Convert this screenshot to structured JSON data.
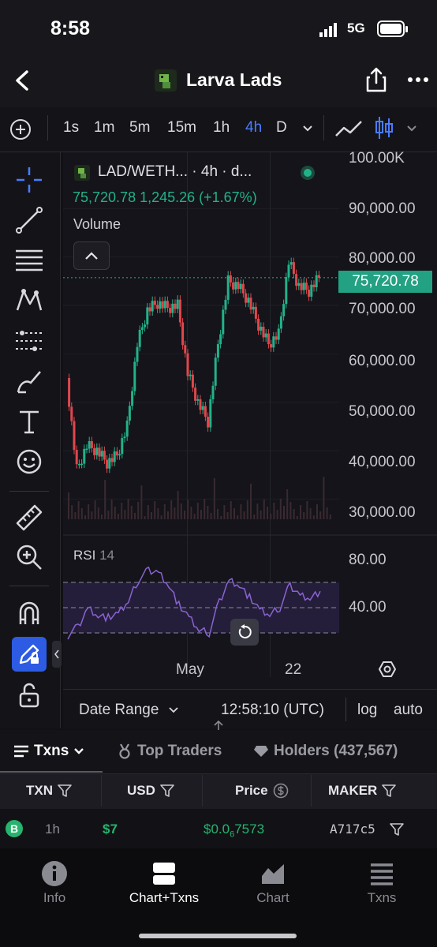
{
  "status_bar": {
    "time": "8:58",
    "network": "5G"
  },
  "header": {
    "title": "Larva Lads"
  },
  "toolbar": {
    "timeframes": [
      "1s",
      "1m",
      "5m",
      "15m",
      "1h",
      "4h",
      "D"
    ],
    "active_timeframe": "4h"
  },
  "chart": {
    "symbol_legend": "LAD/WETH... · 4h · d...",
    "legend_values": "75,720.78  1,245.26 (+1.67%)",
    "volume_label": "Volume",
    "price_ticks": [
      "100.00K",
      "90,000.00",
      "80,000.00",
      "70,000.00",
      "60,000.00",
      "50,000.00",
      "40,000.00",
      "30,000.00"
    ],
    "last_price": "75,720.78",
    "rsi_label": "RSI",
    "rsi_length": "14",
    "rsi_ticks": [
      "80.00",
      "40.00"
    ],
    "time_ticks": [
      "May",
      "22"
    ]
  },
  "chart_data": {
    "type": "line",
    "title": "LAD/WETH... · 4h · d...",
    "ylabel": "",
    "ylim": [
      25000,
      100000
    ],
    "x": [
      0,
      4,
      8,
      12,
      16,
      20,
      24,
      28,
      32,
      36,
      40,
      44,
      48,
      52,
      56,
      60,
      64,
      68,
      72,
      76,
      80,
      84,
      88,
      92,
      96,
      100
    ],
    "series": [
      {
        "name": "",
        "values": [
          55000,
          36000,
          41000,
          40000,
          37500,
          39000,
          45000,
          62000,
          69000,
          70500,
          69500,
          70000,
          56000,
          50000,
          46000,
          62000,
          75000,
          74000,
          71000,
          66000,
          62000,
          64000,
          79000,
          74000,
          73000,
          75720
        ]
      }
    ],
    "rsi": {
      "name": "RSI 14",
      "ylim": [
        20,
        100
      ],
      "bands": [
        30,
        50,
        70
      ],
      "values": [
        28,
        35,
        50,
        44,
        42,
        45,
        55,
        72,
        80,
        78,
        68,
        52,
        42,
        32,
        30,
        55,
        72,
        68,
        58,
        48,
        44,
        50,
        68,
        60,
        58,
        63
      ]
    }
  },
  "controls": {
    "date_range": "Date Range",
    "clock": "12:58:10 (UTC)",
    "log": "log",
    "auto": "auto"
  },
  "tabs": {
    "txns": "Txns",
    "top_traders": "Top Traders",
    "holders": "Holders (437,567)"
  },
  "table": {
    "headers": [
      "TXN",
      "USD",
      "Price",
      "MAKER"
    ],
    "row": {
      "type": "B",
      "age": "1h",
      "usd": "$7",
      "price_prefix": "$0.0",
      "price_zeros": "6",
      "price_digits": "7573",
      "maker": "A717c5"
    }
  },
  "bottom_nav": {
    "items": [
      "Info",
      "Chart+Txns",
      "Chart",
      "Txns"
    ],
    "active": "Chart+Txns"
  },
  "colors": {
    "up": "#22b28a",
    "down": "#e0474c",
    "accent": "#4a7cff",
    "rsi": "#8a63d2"
  }
}
